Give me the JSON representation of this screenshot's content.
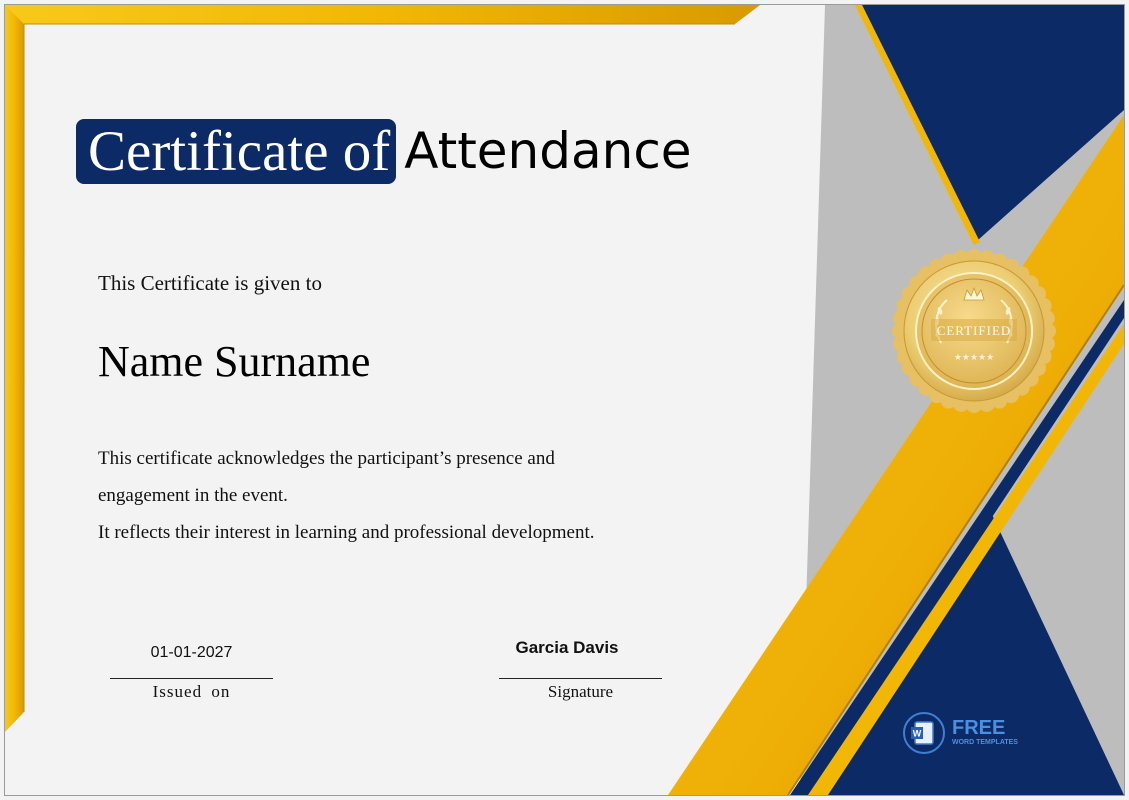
{
  "certificate": {
    "title_highlight": "Certificate of",
    "title_rest": "Attendance",
    "given_to": "This Certificate is given to",
    "recipient_name": "Name Surname",
    "body_lines": [
      "This certificate acknowledges the participant’s presence and",
      "engagement in the event.",
      "It reflects their interest in learning and professional development."
    ],
    "date": "01-01-2027",
    "date_caption": "Issued on",
    "signer_name": "Garcia Davis",
    "signature_caption": "Signature"
  },
  "seal": {
    "label": "CERTIFIED",
    "icon": "crown-laurel-seal"
  },
  "brand": {
    "line1": "FREE",
    "line2": "WORD TEMPLATES",
    "icon": "word-document-icon"
  },
  "colors": {
    "navy": "#0c2a66",
    "gold": "#f2b705",
    "gray": "#bdbdbd",
    "paper": "#f3f3f3"
  }
}
